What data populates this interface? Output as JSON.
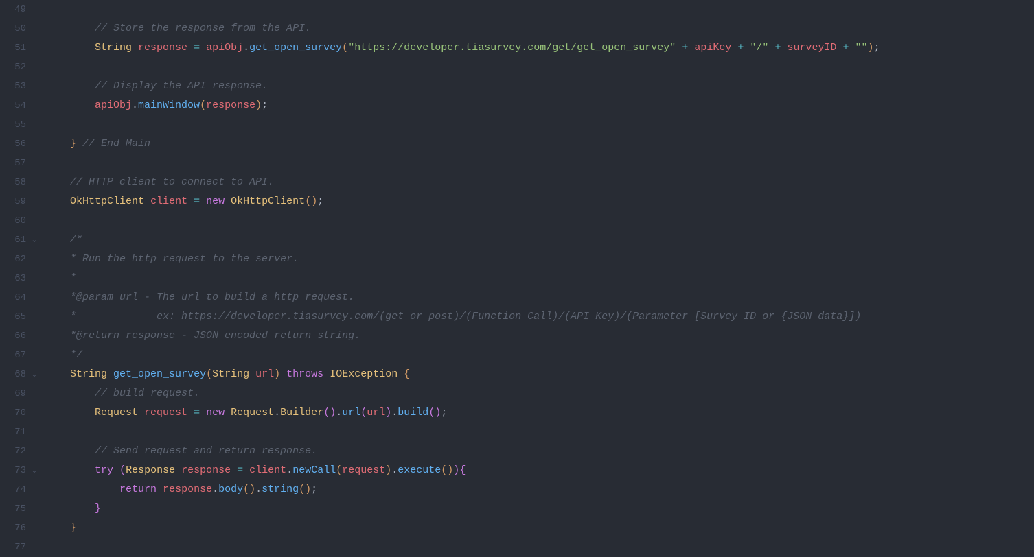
{
  "lines": [
    {
      "num": "49",
      "fold": "",
      "tokens": []
    },
    {
      "num": "50",
      "fold": "",
      "tokens": [
        {
          "t": "        ",
          "c": ""
        },
        {
          "t": "// Store the response from the API.",
          "c": "tok-comment"
        }
      ]
    },
    {
      "num": "51",
      "fold": "",
      "tokens": [
        {
          "t": "        ",
          "c": ""
        },
        {
          "t": "String",
          "c": "tok-type"
        },
        {
          "t": " ",
          "c": ""
        },
        {
          "t": "response",
          "c": "tok-var"
        },
        {
          "t": " ",
          "c": ""
        },
        {
          "t": "=",
          "c": "tok-op"
        },
        {
          "t": " ",
          "c": ""
        },
        {
          "t": "apiObj",
          "c": "tok-var"
        },
        {
          "t": ".",
          "c": "tok-punct"
        },
        {
          "t": "get_open_survey",
          "c": "tok-func"
        },
        {
          "t": "(",
          "c": "tok-brace"
        },
        {
          "t": "\"",
          "c": "tok-string"
        },
        {
          "t": "https://developer.tiasurvey.com/get/get_open_survey",
          "c": "tok-string-u"
        },
        {
          "t": "\"",
          "c": "tok-string"
        },
        {
          "t": " ",
          "c": ""
        },
        {
          "t": "+",
          "c": "tok-op"
        },
        {
          "t": " ",
          "c": ""
        },
        {
          "t": "apiKey",
          "c": "tok-var"
        },
        {
          "t": " ",
          "c": ""
        },
        {
          "t": "+",
          "c": "tok-op"
        },
        {
          "t": " ",
          "c": ""
        },
        {
          "t": "\"/\"",
          "c": "tok-string"
        },
        {
          "t": " ",
          "c": ""
        },
        {
          "t": "+",
          "c": "tok-op"
        },
        {
          "t": " ",
          "c": ""
        },
        {
          "t": "surveyID",
          "c": "tok-var"
        },
        {
          "t": " ",
          "c": ""
        },
        {
          "t": "+",
          "c": "tok-op"
        },
        {
          "t": " ",
          "c": ""
        },
        {
          "t": "\"\"",
          "c": "tok-string"
        },
        {
          "t": ")",
          "c": "tok-brace"
        },
        {
          "t": ";",
          "c": "tok-punct"
        }
      ]
    },
    {
      "num": "52",
      "fold": "",
      "tokens": []
    },
    {
      "num": "53",
      "fold": "",
      "tokens": [
        {
          "t": "        ",
          "c": ""
        },
        {
          "t": "// Display the API response.",
          "c": "tok-comment"
        }
      ]
    },
    {
      "num": "54",
      "fold": "",
      "tokens": [
        {
          "t": "        ",
          "c": ""
        },
        {
          "t": "apiObj",
          "c": "tok-var"
        },
        {
          "t": ".",
          "c": "tok-punct"
        },
        {
          "t": "mainWindow",
          "c": "tok-func"
        },
        {
          "t": "(",
          "c": "tok-brace"
        },
        {
          "t": "response",
          "c": "tok-var"
        },
        {
          "t": ")",
          "c": "tok-brace"
        },
        {
          "t": ";",
          "c": "tok-punct"
        }
      ]
    },
    {
      "num": "55",
      "fold": "",
      "tokens": []
    },
    {
      "num": "56",
      "fold": "",
      "tokens": [
        {
          "t": "    ",
          "c": ""
        },
        {
          "t": "}",
          "c": "tok-brace"
        },
        {
          "t": " ",
          "c": ""
        },
        {
          "t": "// End Main",
          "c": "tok-comment"
        }
      ]
    },
    {
      "num": "57",
      "fold": "",
      "tokens": []
    },
    {
      "num": "58",
      "fold": "",
      "tokens": [
        {
          "t": "    ",
          "c": ""
        },
        {
          "t": "// HTTP client to connect to API.",
          "c": "tok-comment"
        }
      ]
    },
    {
      "num": "59",
      "fold": "",
      "tokens": [
        {
          "t": "    ",
          "c": ""
        },
        {
          "t": "OkHttpClient",
          "c": "tok-type"
        },
        {
          "t": " ",
          "c": ""
        },
        {
          "t": "client",
          "c": "tok-var"
        },
        {
          "t": " ",
          "c": ""
        },
        {
          "t": "=",
          "c": "tok-op"
        },
        {
          "t": " ",
          "c": ""
        },
        {
          "t": "new",
          "c": "tok-keyword"
        },
        {
          "t": " ",
          "c": ""
        },
        {
          "t": "OkHttpClient",
          "c": "tok-type"
        },
        {
          "t": "()",
          "c": "tok-brace"
        },
        {
          "t": ";",
          "c": "tok-punct"
        }
      ]
    },
    {
      "num": "60",
      "fold": "",
      "tokens": []
    },
    {
      "num": "61",
      "fold": "v",
      "tokens": [
        {
          "t": "    ",
          "c": ""
        },
        {
          "t": "/*",
          "c": "tok-comment"
        }
      ]
    },
    {
      "num": "62",
      "fold": "",
      "tokens": [
        {
          "t": "    ",
          "c": ""
        },
        {
          "t": "* Run the http request to the server.",
          "c": "tok-comment"
        }
      ]
    },
    {
      "num": "63",
      "fold": "",
      "tokens": [
        {
          "t": "    ",
          "c": ""
        },
        {
          "t": "*",
          "c": "tok-comment"
        }
      ]
    },
    {
      "num": "64",
      "fold": "",
      "tokens": [
        {
          "t": "    ",
          "c": ""
        },
        {
          "t": "*@param url - The url to build a http request.",
          "c": "tok-comment"
        }
      ]
    },
    {
      "num": "65",
      "fold": "",
      "tokens": [
        {
          "t": "    ",
          "c": ""
        },
        {
          "t": "*             ex: ",
          "c": "tok-comment"
        },
        {
          "t": "https://developer.tiasurvey.com/",
          "c": "tok-comment tok-url"
        },
        {
          "t": "(get or post)/(Function Call)/(API_Key)/(Parameter [Survey ID or {JSON data}])",
          "c": "tok-comment"
        }
      ]
    },
    {
      "num": "66",
      "fold": "",
      "tokens": [
        {
          "t": "    ",
          "c": ""
        },
        {
          "t": "*@return response - JSON encoded return string.",
          "c": "tok-comment"
        }
      ]
    },
    {
      "num": "67",
      "fold": "",
      "tokens": [
        {
          "t": "    ",
          "c": ""
        },
        {
          "t": "*/",
          "c": "tok-comment"
        }
      ]
    },
    {
      "num": "68",
      "fold": "v",
      "tokens": [
        {
          "t": "    ",
          "c": ""
        },
        {
          "t": "String",
          "c": "tok-type"
        },
        {
          "t": " ",
          "c": ""
        },
        {
          "t": "get_open_survey",
          "c": "tok-func"
        },
        {
          "t": "(",
          "c": "tok-brace"
        },
        {
          "t": "String",
          "c": "tok-type"
        },
        {
          "t": " ",
          "c": ""
        },
        {
          "t": "url",
          "c": "tok-var"
        },
        {
          "t": ")",
          "c": "tok-brace"
        },
        {
          "t": " ",
          "c": ""
        },
        {
          "t": "throws",
          "c": "tok-keyword"
        },
        {
          "t": " ",
          "c": ""
        },
        {
          "t": "IOException",
          "c": "tok-type"
        },
        {
          "t": " ",
          "c": ""
        },
        {
          "t": "{",
          "c": "tok-brace"
        }
      ]
    },
    {
      "num": "69",
      "fold": "",
      "tokens": [
        {
          "t": "        ",
          "c": ""
        },
        {
          "t": "// build request.",
          "c": "tok-comment"
        }
      ]
    },
    {
      "num": "70",
      "fold": "",
      "tokens": [
        {
          "t": "        ",
          "c": ""
        },
        {
          "t": "Request",
          "c": "tok-type"
        },
        {
          "t": " ",
          "c": ""
        },
        {
          "t": "request",
          "c": "tok-var"
        },
        {
          "t": " ",
          "c": ""
        },
        {
          "t": "=",
          "c": "tok-op"
        },
        {
          "t": " ",
          "c": ""
        },
        {
          "t": "new",
          "c": "tok-keyword"
        },
        {
          "t": " ",
          "c": ""
        },
        {
          "t": "Request",
          "c": "tok-type"
        },
        {
          "t": ".",
          "c": "tok-punct"
        },
        {
          "t": "Builder",
          "c": "tok-type"
        },
        {
          "t": "()",
          "c": "tok-brace2"
        },
        {
          "t": ".",
          "c": "tok-punct"
        },
        {
          "t": "url",
          "c": "tok-func"
        },
        {
          "t": "(",
          "c": "tok-brace2"
        },
        {
          "t": "url",
          "c": "tok-var"
        },
        {
          "t": ")",
          "c": "tok-brace2"
        },
        {
          "t": ".",
          "c": "tok-punct"
        },
        {
          "t": "build",
          "c": "tok-func"
        },
        {
          "t": "()",
          "c": "tok-brace2"
        },
        {
          "t": ";",
          "c": "tok-punct"
        }
      ]
    },
    {
      "num": "71",
      "fold": "",
      "tokens": []
    },
    {
      "num": "72",
      "fold": "",
      "tokens": [
        {
          "t": "        ",
          "c": ""
        },
        {
          "t": "// Send request and return response.",
          "c": "tok-comment"
        }
      ]
    },
    {
      "num": "73",
      "fold": "v",
      "tokens": [
        {
          "t": "        ",
          "c": ""
        },
        {
          "t": "try",
          "c": "tok-keyword"
        },
        {
          "t": " ",
          "c": ""
        },
        {
          "t": "(",
          "c": "tok-brace2"
        },
        {
          "t": "Response",
          "c": "tok-type"
        },
        {
          "t": " ",
          "c": ""
        },
        {
          "t": "response",
          "c": "tok-var"
        },
        {
          "t": " ",
          "c": ""
        },
        {
          "t": "=",
          "c": "tok-op"
        },
        {
          "t": " ",
          "c": ""
        },
        {
          "t": "client",
          "c": "tok-var"
        },
        {
          "t": ".",
          "c": "tok-punct"
        },
        {
          "t": "newCall",
          "c": "tok-func"
        },
        {
          "t": "(",
          "c": "tok-brace"
        },
        {
          "t": "request",
          "c": "tok-var"
        },
        {
          "t": ")",
          "c": "tok-brace"
        },
        {
          "t": ".",
          "c": "tok-punct"
        },
        {
          "t": "execute",
          "c": "tok-func"
        },
        {
          "t": "()",
          "c": "tok-brace"
        },
        {
          "t": ")",
          "c": "tok-brace2"
        },
        {
          "t": "{",
          "c": "tok-brace2"
        }
      ]
    },
    {
      "num": "74",
      "fold": "",
      "tokens": [
        {
          "t": "            ",
          "c": ""
        },
        {
          "t": "return",
          "c": "tok-keyword"
        },
        {
          "t": " ",
          "c": ""
        },
        {
          "t": "response",
          "c": "tok-var"
        },
        {
          "t": ".",
          "c": "tok-punct"
        },
        {
          "t": "body",
          "c": "tok-func"
        },
        {
          "t": "()",
          "c": "tok-brace"
        },
        {
          "t": ".",
          "c": "tok-punct"
        },
        {
          "t": "string",
          "c": "tok-func"
        },
        {
          "t": "()",
          "c": "tok-brace"
        },
        {
          "t": ";",
          "c": "tok-punct"
        }
      ]
    },
    {
      "num": "75",
      "fold": "",
      "tokens": [
        {
          "t": "        ",
          "c": ""
        },
        {
          "t": "}",
          "c": "tok-brace2"
        }
      ]
    },
    {
      "num": "76",
      "fold": "",
      "tokens": [
        {
          "t": "    ",
          "c": ""
        },
        {
          "t": "}",
          "c": "tok-brace"
        }
      ]
    },
    {
      "num": "77",
      "fold": "",
      "tokens": []
    }
  ]
}
